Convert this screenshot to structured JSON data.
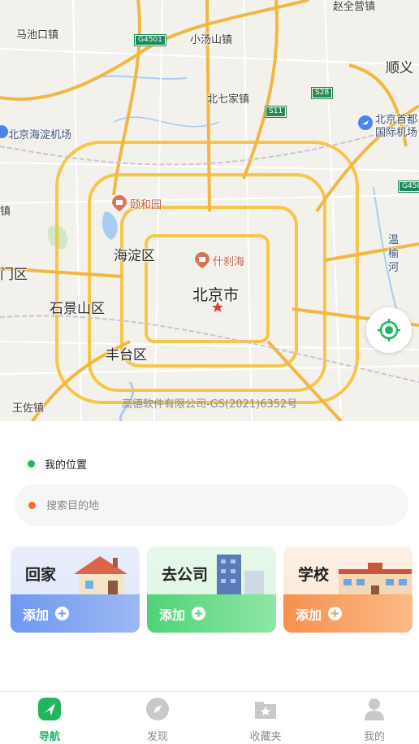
{
  "map": {
    "labels": {
      "machikou": "马池口镇",
      "xiaotangshan": "小汤山镇",
      "zhaoquanying": "赵全营镇",
      "shunyi": "顺义",
      "beiqijia": "北七家镇",
      "haidian_airport": "北京海淀机场",
      "capital_airport_1": "北京首都",
      "capital_airport_2": "国际机场",
      "yiheyuan": "颐和园",
      "haidian": "海淀区",
      "shichahai": "什刹海",
      "wenyu_1": "温",
      "wenyu_2": "榆",
      "wenyu_3": "河",
      "beijing": "北京市",
      "shijingshan": "石景山区",
      "fengtai": "丰台区",
      "wangzuo": "王佐镇",
      "left_zhen": "镇",
      "left_qu": "门区"
    },
    "shields": {
      "g4501_top": "G4501",
      "s11": "S11",
      "s28": "S28",
      "g450_right": "G450"
    },
    "copyright": "高德软件有限公司-GS(2021)6352号"
  },
  "location": {
    "my_location": "我的位置",
    "dot_color": "#1db954"
  },
  "search": {
    "placeholder": "搜索目的地",
    "dot_color": "#f26b2a"
  },
  "shortcuts": [
    {
      "title": "回家",
      "add_label": "添加"
    },
    {
      "title": "去公司",
      "add_label": "添加"
    },
    {
      "title": "学校",
      "add_label": "添加"
    }
  ],
  "tabs": [
    {
      "label": "导航",
      "icon": "navigation-arrow-icon",
      "active": true
    },
    {
      "label": "发现",
      "icon": "compass-icon",
      "active": false
    },
    {
      "label": "收藏夹",
      "icon": "favorites-folder-icon",
      "active": false
    },
    {
      "label": "我的",
      "icon": "user-icon",
      "active": false
    }
  ],
  "colors": {
    "accent": "#1fb660",
    "home_card": "#7ea6f2",
    "company_card": "#5fd882",
    "school_card": "#f9a15f"
  }
}
